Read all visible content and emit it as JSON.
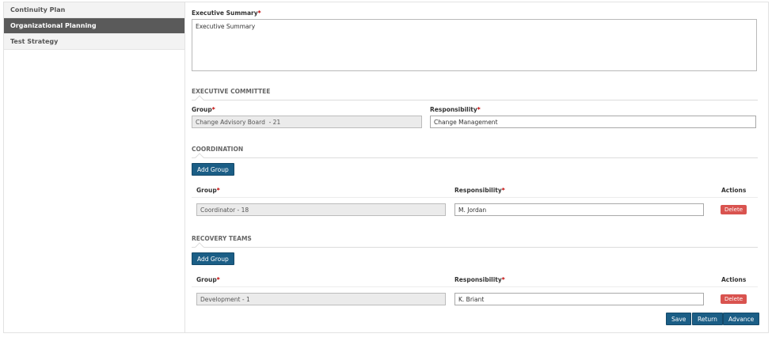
{
  "sidebar": {
    "items": [
      {
        "label": "Continuity Plan"
      },
      {
        "label": "Organizational Planning"
      },
      {
        "label": "Test Strategy"
      }
    ]
  },
  "executive_summary": {
    "label": "Executive Summary",
    "value": "Executive Summary"
  },
  "executive_committee": {
    "title": "EXECUTIVE COMMITTEE",
    "group_label": "Group",
    "responsibility_label": "Responsibility",
    "group_value": "Change Advisory Board  - 21",
    "responsibility_value": "Change Management"
  },
  "coordination": {
    "title": "COORDINATION",
    "add_label": "Add Group",
    "col_group": "Group",
    "col_responsibility": "Responsibility",
    "col_actions": "Actions",
    "rows": [
      {
        "group": "Coordinator - 18",
        "responsibility": "M. Jordan",
        "delete_label": "Delete"
      }
    ]
  },
  "recovery_teams": {
    "title": "RECOVERY TEAMS",
    "add_label": "Add Group",
    "col_group": "Group",
    "col_responsibility": "Responsibility",
    "col_actions": "Actions",
    "rows": [
      {
        "group": "Development - 1",
        "responsibility": "K. Briant",
        "delete_label": "Delete"
      }
    ]
  },
  "footer": {
    "save_label": "Save",
    "return_label": "Return",
    "advance_label": "Advance"
  },
  "required_marker": "*",
  "colors": {
    "primary": "#1b5e86",
    "danger": "#d9534f",
    "sidebar_active": "#5a5a5a",
    "required": "#c00000"
  }
}
